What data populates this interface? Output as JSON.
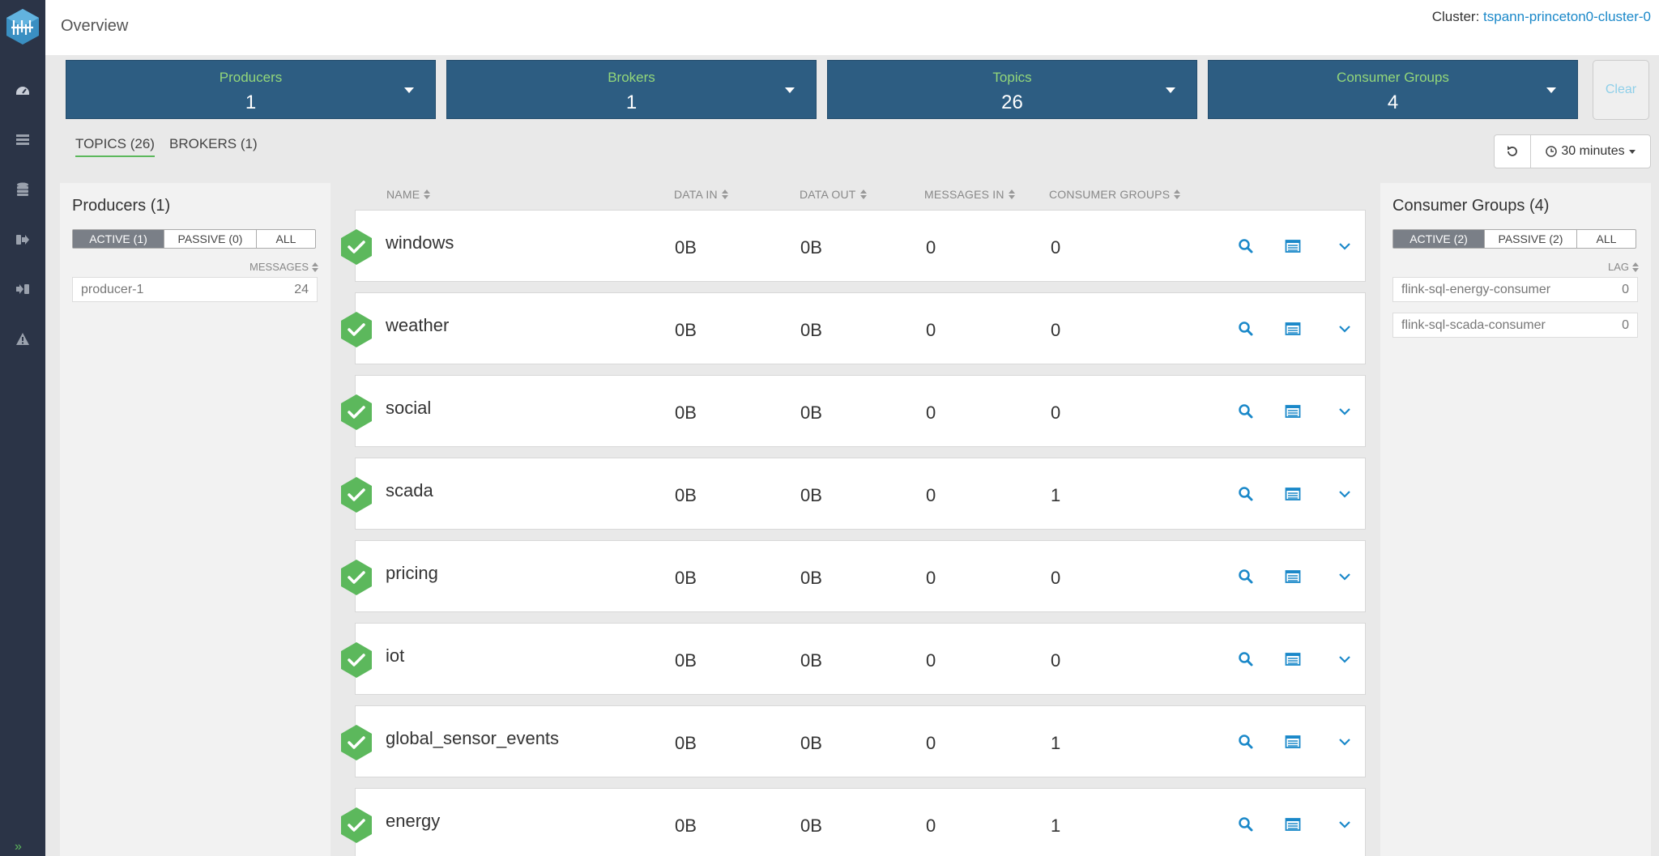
{
  "header": {
    "title": "Overview",
    "cluster_label": "Cluster: ",
    "cluster_name": "tspann-princeton0-cluster-0"
  },
  "nav": {
    "icons": [
      "dashboard-icon",
      "brokers-icon",
      "database-icon",
      "sign-out-icon",
      "sign-in-icon",
      "alert-icon"
    ],
    "expand_label": "»"
  },
  "summary": {
    "producers": {
      "label": "Producers",
      "value": "1"
    },
    "brokers": {
      "label": "Brokers",
      "value": "1"
    },
    "topics": {
      "label": "Topics",
      "value": "26"
    },
    "consumer_groups": {
      "label": "Consumer Groups",
      "value": "4"
    },
    "clear_label": "Clear"
  },
  "tabs": {
    "topics": "TOPICS (26)",
    "brokers": "BROKERS (1)"
  },
  "time_range": "30 minutes",
  "producers_panel": {
    "title": "Producers (1)",
    "filters": [
      "ACTIVE (1)",
      "PASSIVE (0)",
      "ALL"
    ],
    "column": "MESSAGES",
    "rows": [
      {
        "name": "producer-1",
        "value": "24"
      }
    ]
  },
  "consumers_panel": {
    "title": "Consumer Groups (4)",
    "filters": [
      "ACTIVE (2)",
      "PASSIVE (2)",
      "ALL"
    ],
    "column": "LAG",
    "rows": [
      {
        "name": "flink-sql-energy-consumer",
        "value": "0"
      },
      {
        "name": "flink-sql-scada-consumer",
        "value": "0"
      }
    ]
  },
  "topics_table": {
    "columns": [
      "NAME",
      "DATA IN",
      "DATA OUT",
      "MESSAGES IN",
      "CONSUMER GROUPS"
    ],
    "rows": [
      {
        "name": "windows",
        "data_in": "0B",
        "data_out": "0B",
        "messages_in": "0",
        "consumer_groups": "0"
      },
      {
        "name": "weather",
        "data_in": "0B",
        "data_out": "0B",
        "messages_in": "0",
        "consumer_groups": "0"
      },
      {
        "name": "social",
        "data_in": "0B",
        "data_out": "0B",
        "messages_in": "0",
        "consumer_groups": "0"
      },
      {
        "name": "scada",
        "data_in": "0B",
        "data_out": "0B",
        "messages_in": "0",
        "consumer_groups": "1"
      },
      {
        "name": "pricing",
        "data_in": "0B",
        "data_out": "0B",
        "messages_in": "0",
        "consumer_groups": "0"
      },
      {
        "name": "iot",
        "data_in": "0B",
        "data_out": "0B",
        "messages_in": "0",
        "consumer_groups": "0"
      },
      {
        "name": "global_sensor_events",
        "data_in": "0B",
        "data_out": "0B",
        "messages_in": "0",
        "consumer_groups": "1"
      },
      {
        "name": "energy",
        "data_in": "0B",
        "data_out": "0B",
        "messages_in": "0",
        "consumer_groups": "1"
      }
    ]
  },
  "colors": {
    "nav_bg": "#2b3447",
    "card_bg": "#2d5d82",
    "card_label": "#93d77a",
    "success": "#5cb85c",
    "link": "#1a88c9"
  }
}
